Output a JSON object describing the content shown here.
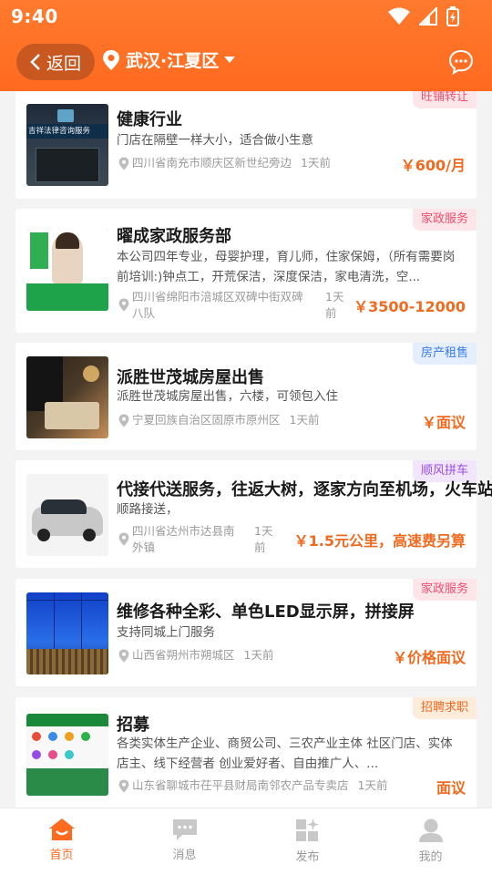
{
  "status": {
    "time": "9:40"
  },
  "nav": {
    "back_label": "返回",
    "location_label": "武汉·江夏区"
  },
  "listings": [
    {
      "title": "健康行业",
      "desc": "门店在隔壁一样大小，适合做小生意",
      "address": "四川省南充市顺庆区新世纪旁边",
      "ago": "1天前",
      "price": "￥600/月",
      "tag": "旺铺转让",
      "tag_color": "pink",
      "thumb_text": "吉祥法律咨询服务"
    },
    {
      "title": "曜成家政服务部",
      "desc": "本公司四年专业，母婴护理，育儿师，住家保姆，（所有需要岗前培训:)钟点工，开荒保洁，深度保洁，家电清洗，空...",
      "address": "四川省绵阳市涪城区双碑中街双碑八队",
      "ago": "1天前",
      "price": "￥3500-12000",
      "tag": "家政服务",
      "tag_color": "pink",
      "thumb_text": ""
    },
    {
      "title": "派胜世茂城房屋出售",
      "desc": "派胜世茂城房屋出售，六楼，可领包入住",
      "address": "宁夏回族自治区固原市原州区",
      "ago": "1天前",
      "price": "￥面议",
      "tag": "房产租售",
      "tag_color": "blue",
      "thumb_text": ""
    },
    {
      "title": "代接代送服务，往返大树，逐家方向至机场，火车站",
      "desc": "顺路接送，",
      "address": "四川省达州市达县南外镇",
      "ago": "1天前",
      "price": "￥1.5元公里，高速费另算",
      "tag": "顺风拼车",
      "tag_color": "purple",
      "thumb_text": ""
    },
    {
      "title": "维修各种全彩、单色LED显示屏，拼接屏",
      "desc": "支持同城上门服务",
      "address": "山西省朔州市朔城区",
      "ago": "1天前",
      "price": "￥价格面议",
      "tag": "家政服务",
      "tag_color": "pink",
      "thumb_text": ""
    },
    {
      "title": "招募",
      "desc": "各类实体生产企业、商贸公司、三农产业主体 社区门店、实体店主、线下经营者 创业爱好者、自由推广人、...",
      "address": "山东省聊城市茌平县财局南邻农产品专卖店",
      "ago": "1天前",
      "price": "面议",
      "tag": "招聘求职",
      "tag_color": "orange",
      "thumb_text": ""
    }
  ],
  "tabs": [
    {
      "label": "首页",
      "icon": "home-icon"
    },
    {
      "label": "消息",
      "icon": "message-icon"
    },
    {
      "label": "发布",
      "icon": "publish-icon"
    },
    {
      "label": "我的",
      "icon": "profile-icon"
    }
  ],
  "colors": {
    "brand": "#ff6a1f",
    "price": "#f06a1f"
  }
}
